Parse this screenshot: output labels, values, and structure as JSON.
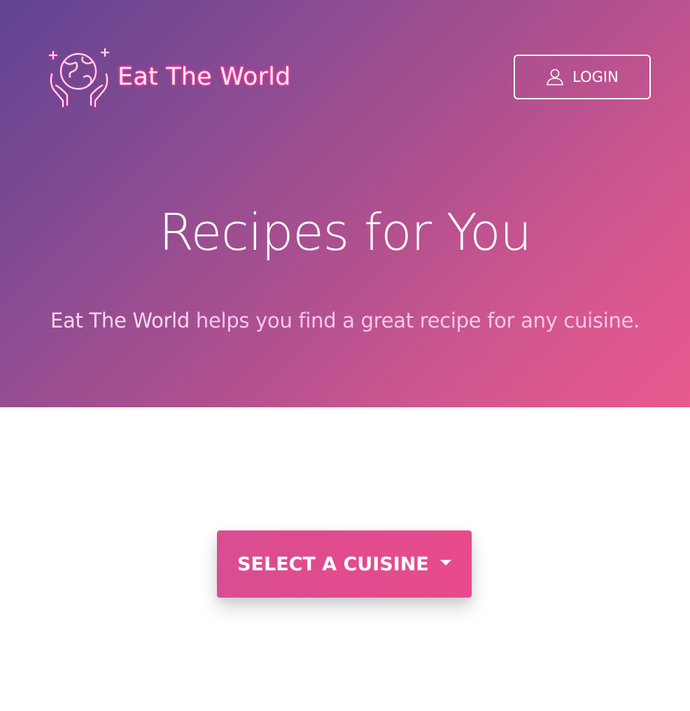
{
  "header": {
    "brand_name": "Eat The World",
    "logo_icon": "globe-in-hands-icon",
    "login_label": "LOGIN",
    "login_icon": "user-icon"
  },
  "hero": {
    "title": "Recipes for You",
    "subtitle_brand": "Eat The World",
    "subtitle_rest": " helps you find a great recipe for any cuisine."
  },
  "cuisine_select": {
    "label": "SELECT A CUISINE",
    "icon": "caret-down-icon"
  },
  "colors": {
    "gradient_start": "#5f4393",
    "gradient_end": "#e9598d",
    "accent": "#e84b8c",
    "neon_pink": "#ff3b9a"
  }
}
